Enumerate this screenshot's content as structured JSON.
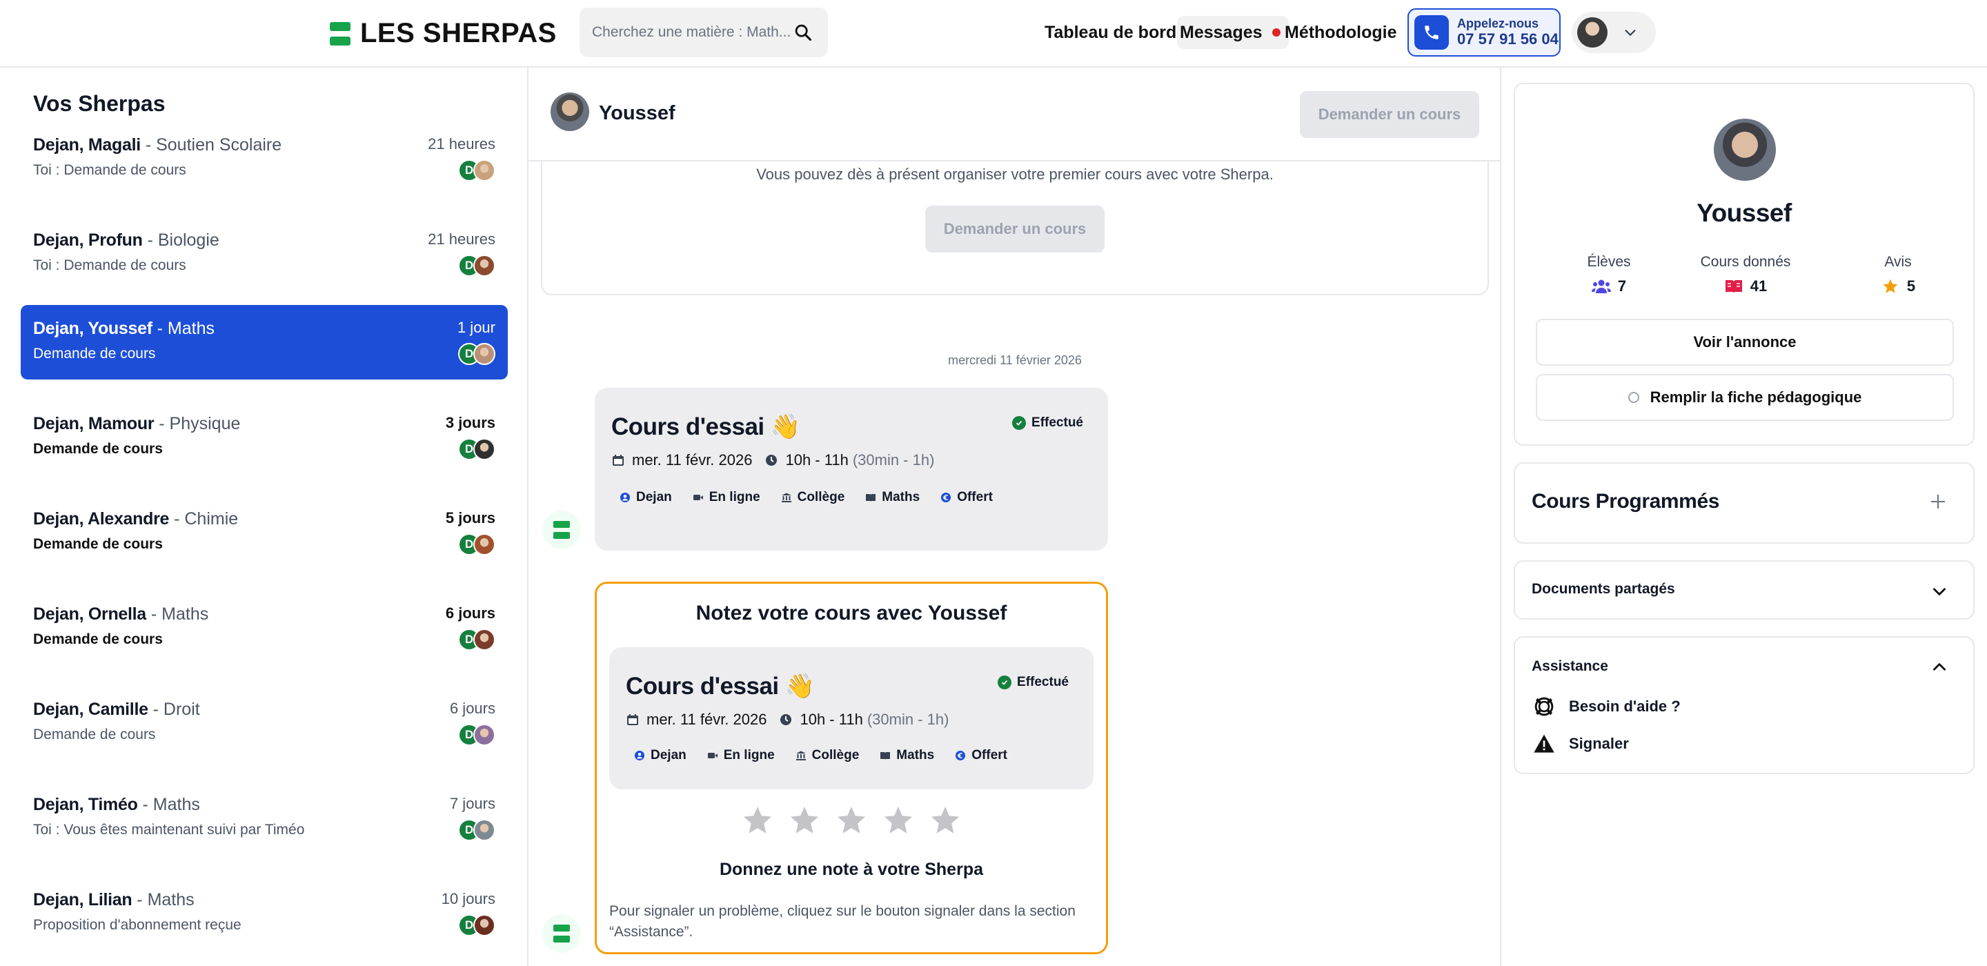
{
  "header": {
    "logo_text": "LES SHERPAS",
    "search_placeholder": "Cherchez une matière : Math...",
    "nav": {
      "dashboard": "Tableau de bord",
      "messages": "Messages",
      "methodology": "Méthodologie"
    },
    "call": {
      "label": "Appelez-nous",
      "number": "07 57 91 56 04"
    }
  },
  "sidebar": {
    "title": "Vos Sherpas",
    "conversations": [
      {
        "name": "Dejan, Magali",
        "subject": " - Soutien Scolaire",
        "time": "21 heures",
        "preview": "Toi : Demande de cours",
        "unread": false
      },
      {
        "name": "Dejan, Profun",
        "subject": " - Biologie",
        "time": "21 heures",
        "preview": "Toi : Demande de cours",
        "unread": false
      },
      {
        "name": "Dejan, Youssef",
        "subject": " - Maths",
        "time": "1 jour",
        "preview": "Demande de cours",
        "unread": false
      },
      {
        "name": "Dejan, Mamour",
        "subject": " - Physique",
        "time": "3 jours",
        "preview": "Demande de cours",
        "unread": true
      },
      {
        "name": "Dejan, Alexandre",
        "subject": " - Chimie",
        "time": "5 jours",
        "preview": "Demande de cours",
        "unread": true
      },
      {
        "name": "Dejan, Ornella",
        "subject": " - Maths",
        "time": "6 jours",
        "preview": "Demande de cours",
        "unread": true
      },
      {
        "name": "Dejan, Camille",
        "subject": " - Droit",
        "time": "6 jours",
        "preview": "Demande de cours",
        "unread": false
      },
      {
        "name": "Dejan, Timéo",
        "subject": " - Maths",
        "time": "7 jours",
        "preview": "Toi : Vous êtes maintenant suivi par Timéo",
        "unread": false
      },
      {
        "name": "Dejan, Lilian",
        "subject": " - Maths",
        "time": "10 jours",
        "preview": "Proposition d'abonnement reçue",
        "unread": false
      }
    ],
    "avatar_initial": "D"
  },
  "chat": {
    "name": "Youssef",
    "request_button": "Demander un cours",
    "intro_text": "Vous pouvez dès à présent organiser votre premier cours avec votre Sherpa.",
    "date_separator": "mercredi 11 février 2026",
    "course": {
      "title": "Cours d'essai 👋",
      "status": "Effectué",
      "date": "mer. 11 févr. 2026",
      "time": "10h - 11h",
      "duration": "(30min - 1h)",
      "tags": [
        "Dejan",
        "En ligne",
        "Collège",
        "Maths",
        "Offert"
      ]
    },
    "rating": {
      "title": "Notez votre cours avec Youssef",
      "stars": 0,
      "max_stars": 5,
      "subtitle": "Donnez une note à votre Sherpa",
      "help": "Pour signaler un problème, cliquez sur le bouton signaler dans la section “Assistance”."
    }
  },
  "profile": {
    "name": "Youssef",
    "stats": [
      {
        "label": "Élèves",
        "value": "7"
      },
      {
        "label": "Cours donnés",
        "value": "41"
      },
      {
        "label": "Avis",
        "value": "5"
      }
    ],
    "view_listing": "Voir l'annonce",
    "fill_sheet": "Remplir la fiche pédagogique"
  },
  "panels": {
    "scheduled": "Cours Programmés",
    "documents": "Documents partagés",
    "assistance": "Assistance",
    "help": "Besoin d'aide ?",
    "report": "Signaler"
  },
  "colors": {
    "accent": "#1d4ed8",
    "brand": "#16a34a",
    "rating_border": "#f59e0b",
    "notif": "#dc2626"
  }
}
